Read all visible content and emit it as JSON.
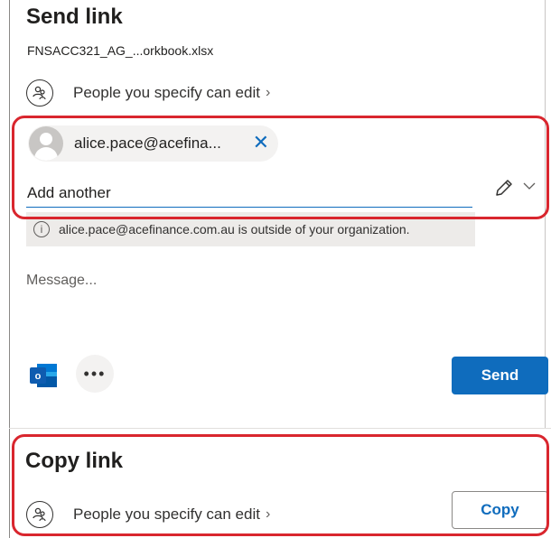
{
  "send": {
    "title": "Send link",
    "filename": "FNSACC321_AG_...orkbook.xlsx",
    "permission": "People you specify can edit",
    "recipient_email": "alice.pace@acefina...",
    "add_placeholder": "Add another",
    "notice": "alice.pace@acefinance.com.au is outside of your organization.",
    "message_placeholder": "Message...",
    "send_label": "Send"
  },
  "copy": {
    "title": "Copy link",
    "permission": "People you specify can edit",
    "copy_label": "Copy"
  },
  "icons": {
    "people": "people-icon",
    "chevron_right": "chevron-right-icon",
    "remove": "close-icon",
    "edit": "pencil-icon",
    "dropdown": "chevron-down-icon",
    "info": "info-icon",
    "outlook": "outlook-icon",
    "more": "more-icon"
  },
  "colors": {
    "accent": "#0f6cbd",
    "highlight": "#d9262e",
    "notice_bg": "#edebe9"
  }
}
